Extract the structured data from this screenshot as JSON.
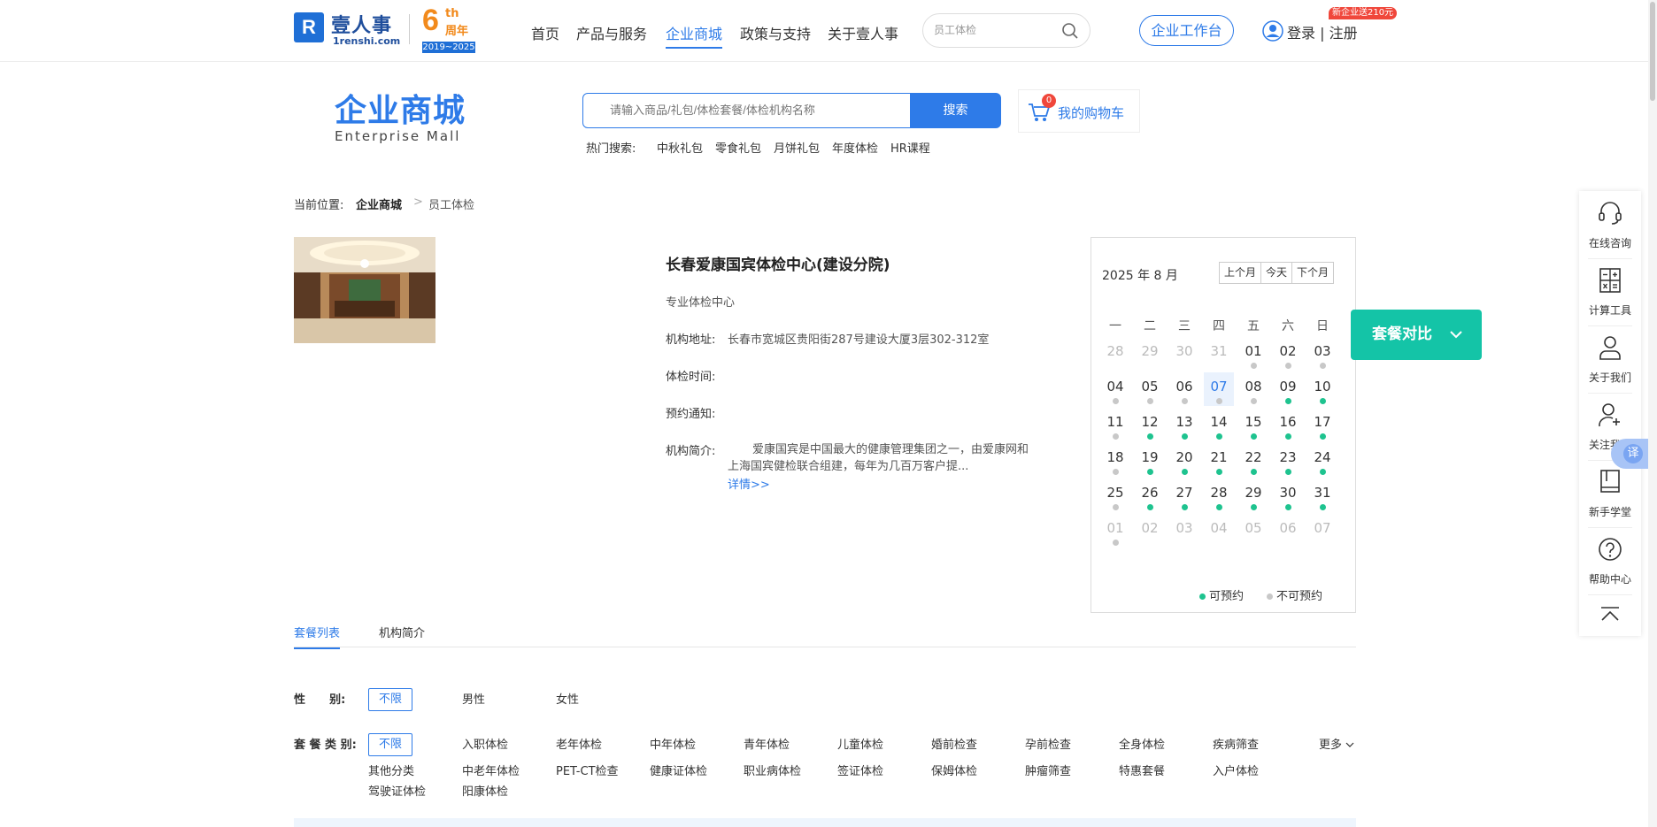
{
  "header": {
    "logo_mark": "R",
    "logo_cn": "壹人事",
    "logo_en": "1renshi.com",
    "anniv_num": "6",
    "anniv_th": "th",
    "anniv_zn": "周年",
    "anniv_years": "2019~2025",
    "nav": [
      "首页",
      "产品与服务",
      "企业商城",
      "政策与支持",
      "关于壹人事"
    ],
    "nav_active_index": 2,
    "search_value": "员工体检",
    "workbench": "企业工作台",
    "login": "登录 | 注册",
    "promo": "新企业送210元"
  },
  "mall": {
    "title_cn": "企业商城",
    "title_en": "Enterprise  Mall",
    "search_placeholder": "请输入商品/礼包/体检套餐/体检机构名称",
    "search_button": "搜索",
    "hot_title": "热门搜索:",
    "hot": [
      "中秋礼包",
      "零食礼包",
      "月饼礼包",
      "年度体检",
      "HR课程"
    ],
    "cart_count": "0",
    "cart_label": "我的购物车"
  },
  "breadcrumb": {
    "prefix": "当前位置:",
    "level1": "企业商城",
    "sep": ">",
    "level2": "员工体检"
  },
  "institution": {
    "name": "长春爱康国宾体检中心(建设分院)",
    "type": "专业体检中心",
    "address_label": "机构地址:",
    "address": "长春市宽城区贵阳街287号建设大厦3层302-312室",
    "hours_label": "体检时间:",
    "hours": "",
    "notice_label": "预约通知:",
    "notice": "",
    "intro_label": "机构简介:",
    "intro": "爱康国宾是中国最大的健康管理集团之一，由爱康网和上海国宾健检联合组建，每年为几百万客户提...",
    "more": "详情>>"
  },
  "calendar": {
    "title": "2025 年 8 月",
    "prev": "上个月",
    "today": "今天",
    "next": "下个月",
    "weekdays": [
      "一",
      "二",
      "三",
      "四",
      "五",
      "六",
      "日"
    ],
    "weeks": [
      [
        [
          "28",
          "dim",
          ""
        ],
        [
          "29",
          "dim",
          ""
        ],
        [
          "30",
          "dim",
          ""
        ],
        [
          "31",
          "dim",
          ""
        ],
        [
          "01",
          "",
          "no"
        ],
        [
          "02",
          "",
          "no"
        ],
        [
          "03",
          "",
          "no"
        ]
      ],
      [
        [
          "04",
          "",
          "no"
        ],
        [
          "05",
          "",
          "no"
        ],
        [
          "06",
          "",
          "no"
        ],
        [
          "07",
          "today",
          "no"
        ],
        [
          "08",
          "",
          "no"
        ],
        [
          "09",
          "",
          "yes"
        ],
        [
          "10",
          "",
          "yes"
        ]
      ],
      [
        [
          "11",
          "",
          "no"
        ],
        [
          "12",
          "",
          "yes"
        ],
        [
          "13",
          "",
          "yes"
        ],
        [
          "14",
          "",
          "yes"
        ],
        [
          "15",
          "",
          "yes"
        ],
        [
          "16",
          "",
          "yes"
        ],
        [
          "17",
          "",
          "yes"
        ]
      ],
      [
        [
          "18",
          "",
          "no"
        ],
        [
          "19",
          "",
          "yes"
        ],
        [
          "20",
          "",
          "yes"
        ],
        [
          "21",
          "",
          "yes"
        ],
        [
          "22",
          "",
          "yes"
        ],
        [
          "23",
          "",
          "yes"
        ],
        [
          "24",
          "",
          "yes"
        ]
      ],
      [
        [
          "25",
          "",
          "no"
        ],
        [
          "26",
          "",
          "yes"
        ],
        [
          "27",
          "",
          "yes"
        ],
        [
          "28",
          "",
          "yes"
        ],
        [
          "29",
          "",
          "yes"
        ],
        [
          "30",
          "",
          "yes"
        ],
        [
          "31",
          "",
          "yes"
        ]
      ],
      [
        [
          "01",
          "dim",
          "no"
        ],
        [
          "02",
          "dim",
          ""
        ],
        [
          "03",
          "dim",
          ""
        ],
        [
          "04",
          "dim",
          ""
        ],
        [
          "05",
          "dim",
          ""
        ],
        [
          "06",
          "dim",
          ""
        ],
        [
          "07",
          "dim",
          ""
        ]
      ]
    ],
    "legend_yes": "可预约",
    "legend_no": "不可预约",
    "color_yes": "#1ec38f",
    "color_no": "#c8c8c8"
  },
  "compare_button": "套餐对比",
  "rail": [
    "在线咨询",
    "计算工具",
    "关于我们",
    "关注我们",
    "新手学堂",
    "帮助中心"
  ],
  "translate_label": "译",
  "tabs": [
    "套餐列表",
    "机构简介"
  ],
  "filters": {
    "gender_label": "性      别:",
    "gender": [
      "不限",
      "男性",
      "女性"
    ],
    "category_label": "套 餐 类 别:",
    "category_row1": [
      "不限",
      "入职体检",
      "老年体检",
      "中年体检",
      "青年体检",
      "儿童体检",
      "婚前检查",
      "孕前检查",
      "全身体检",
      "疾病筛查"
    ],
    "category_row2": [
      "其他分类",
      "中老年体检",
      "PET-CT检查",
      "健康证体检",
      "职业病体检",
      "签证体检",
      "保姆体检",
      "肿瘤筛查",
      "特惠套餐",
      "入户体检"
    ],
    "category_row3": [
      "驾驶证体检",
      "阳康体检"
    ],
    "more": "更多"
  },
  "colors": {
    "accent": "#2e7be8",
    "teal": "#14c4a7",
    "promo": "#f0473b"
  }
}
